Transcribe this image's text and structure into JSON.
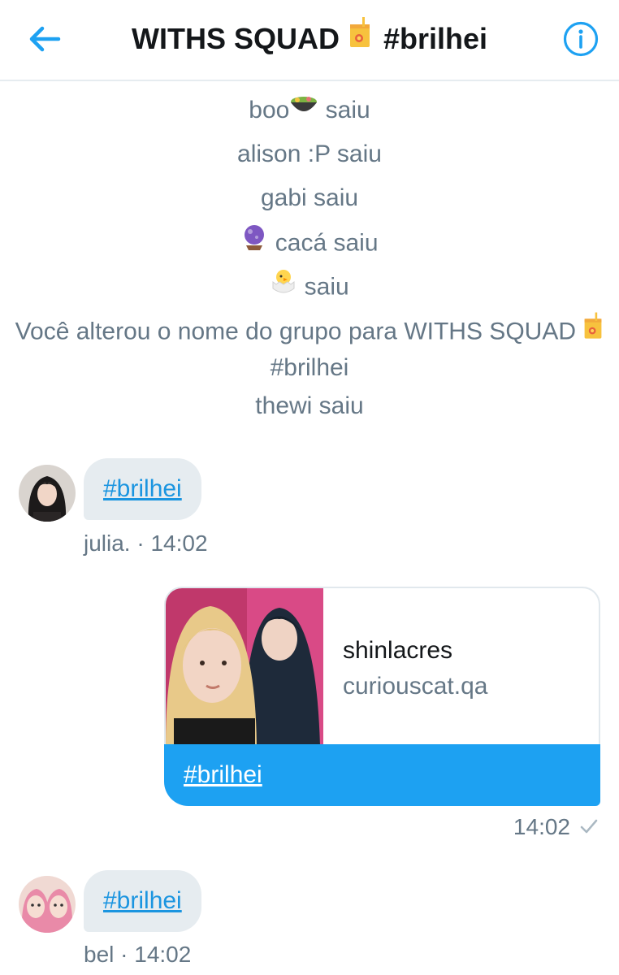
{
  "header": {
    "back_icon": "arrow-left-icon",
    "title_part1": "WITHS SQUAD",
    "title_emoji": "beverage-box-icon",
    "title_part2": "#brilhei",
    "info_icon": "info-icon"
  },
  "system_messages": [
    {
      "text": "boo",
      "emoji": "bowl-with-food-icon",
      "suffix": "saiu"
    },
    {
      "text": "alison :P saiu"
    },
    {
      "text": "gabi saiu"
    },
    {
      "emoji": "crystal-ball-icon",
      "text": "cacá saiu"
    },
    {
      "emoji": "hatching-chick-icon",
      "text": "saiu"
    },
    {
      "text": "Você alterou o nome do grupo para WITHS SQUAD",
      "emoji": "beverage-box-icon",
      "line2": "#brilhei"
    },
    {
      "text": "thewi saiu"
    }
  ],
  "messages": [
    {
      "sender": "julia.",
      "time": "14:02",
      "text": "#brilhei",
      "meta": "julia. · 14:02"
    },
    {
      "outgoing": true,
      "card": {
        "title": "shinlacres",
        "domain": "curiouscat.qa"
      },
      "text": "#brilhei",
      "time": "14:02",
      "status_icon": "check-icon"
    },
    {
      "sender": "bel",
      "time": "14:02",
      "text": "#brilhei",
      "meta": "bel · 14:02"
    }
  ],
  "colors": {
    "accent": "#1da1f2",
    "link": "#1b95e0",
    "muted": "#657786",
    "bubble_in": "#e6ecf0"
  }
}
